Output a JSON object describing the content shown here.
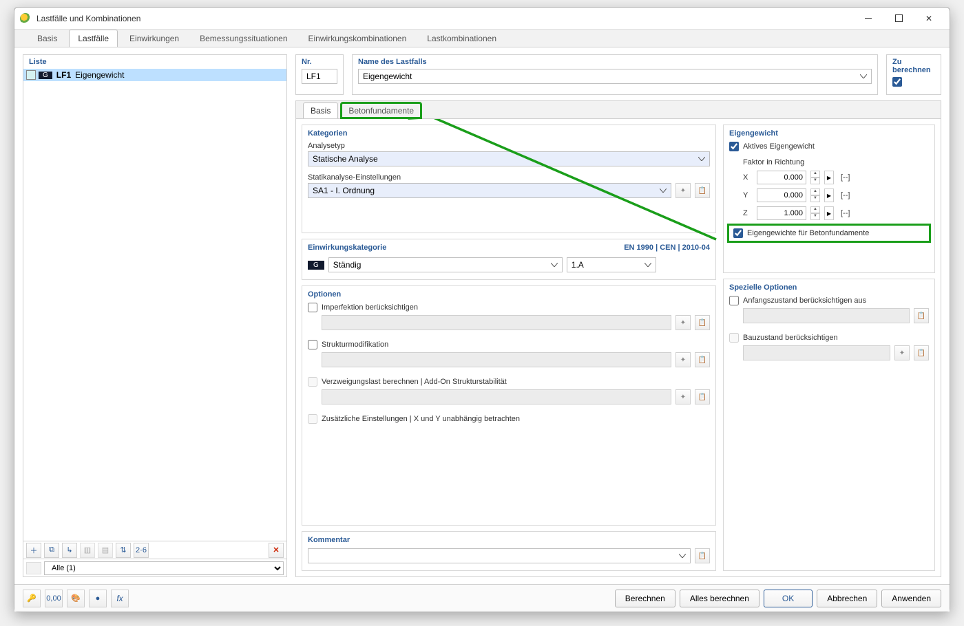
{
  "window": {
    "title": "Lastfälle und Kombinationen"
  },
  "main_tabs": [
    "Basis",
    "Lastfälle",
    "Einwirkungen",
    "Bemessungssituationen",
    "Einwirkungskombinationen",
    "Lastkombinationen"
  ],
  "main_tabs_active": 1,
  "left": {
    "head": "Liste",
    "items": [
      {
        "tag": "G",
        "code": "LF1",
        "name": "Eigengewicht"
      }
    ],
    "filter": "Alle (1)"
  },
  "nr_label": "Nr.",
  "nr_value": "LF1",
  "name_label": "Name des Lastfalls",
  "name_value": "Eigengewicht",
  "calc_label": "Zu berechnen",
  "sub_tabs": [
    "Basis",
    "Betonfundamente"
  ],
  "sub_tabs_active": 0,
  "kategorien": {
    "title": "Kategorien",
    "analysetyp_label": "Analysetyp",
    "analysetyp_value": "Statische Analyse",
    "statik_label": "Statikanalyse-Einstellungen",
    "statik_value": "SA1 - I. Ordnung"
  },
  "einw": {
    "title": "Einwirkungskategorie",
    "code": "EN 1990 | CEN | 2010-04",
    "tag": "G",
    "value": "Ständig",
    "sub": "1.A"
  },
  "optionen": {
    "title": "Optionen",
    "imperfektion": "Imperfektion berücksichtigen",
    "struktur": "Strukturmodifikation",
    "verzweigung": "Verzweigungslast berechnen | Add-On Strukturstabilität",
    "zusatz": "Zusätzliche Einstellungen | X und Y unabhängig betrachten"
  },
  "eigengewicht": {
    "title": "Eigengewicht",
    "aktiv": "Aktives Eigengewicht",
    "faktor_label": "Faktor in Richtung",
    "rows": [
      {
        "axis": "X",
        "val": "0.000"
      },
      {
        "axis": "Y",
        "val": "0.000"
      },
      {
        "axis": "Z",
        "val": "1.000"
      }
    ],
    "unit": "[--]",
    "beton": "Eigengewichte für Betonfundamente"
  },
  "spezielle": {
    "title": "Spezielle Optionen",
    "anfang": "Anfangszustand berücksichtigen aus",
    "bau": "Bauzustand berücksichtigen"
  },
  "kommentar": {
    "title": "Kommentar"
  },
  "footer": {
    "berechnen": "Berechnen",
    "alles": "Alles berechnen",
    "ok": "OK",
    "abbrechen": "Abbrechen",
    "anwenden": "Anwenden"
  }
}
